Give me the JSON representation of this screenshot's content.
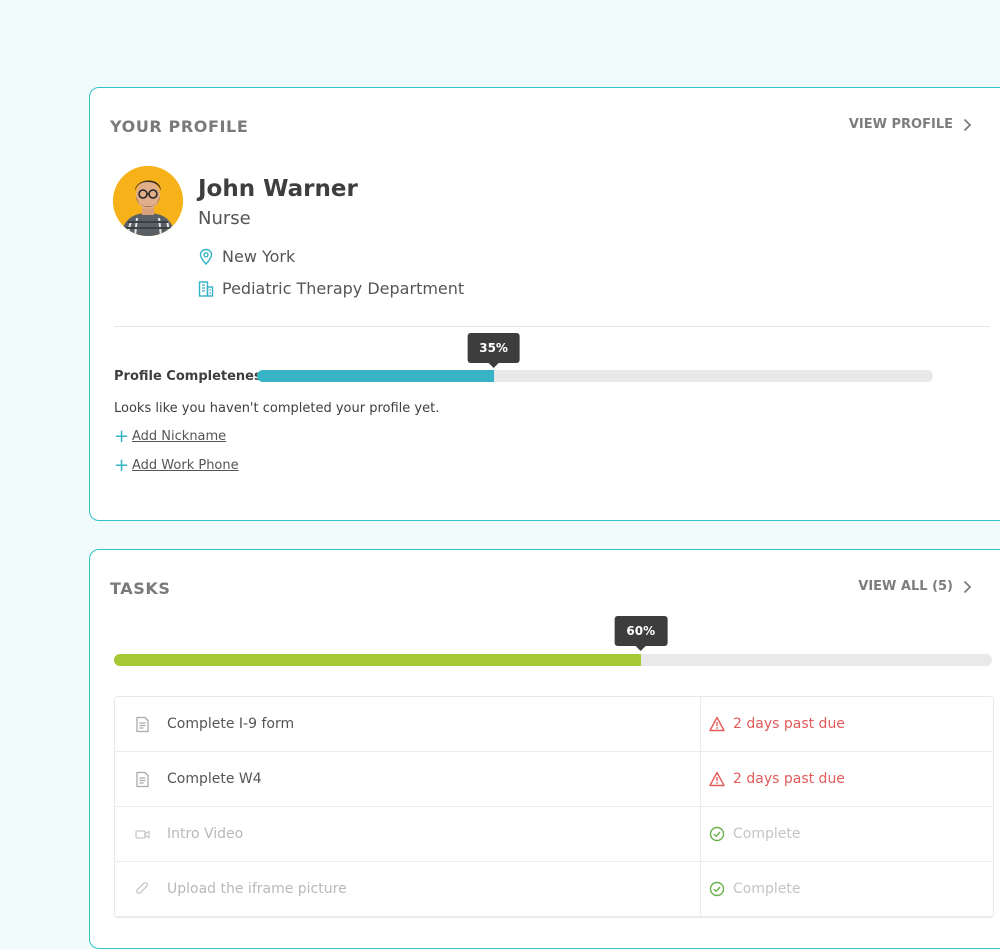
{
  "profile": {
    "title": "YOUR PROFILE",
    "view_link": "VIEW PROFILE",
    "name": "John Warner",
    "role": "Nurse",
    "location": "New York",
    "department": "Pediatric Therapy Department",
    "completeness_label": "Profile Completeness",
    "completeness_value": 35,
    "completeness_text": "35%",
    "note": "Looks like you haven't completed your profile yet.",
    "actions": [
      {
        "label": "Add Nickname"
      },
      {
        "label": "Add Work Phone"
      }
    ]
  },
  "tasks": {
    "title": "TASKS",
    "view_link": "VIEW ALL (5)",
    "progress_value": 60,
    "progress_text": "60%",
    "items": [
      {
        "name": "Complete I-9 form",
        "status": "2 days past due",
        "state": "overdue",
        "icon": "document-icon"
      },
      {
        "name": "Complete W4",
        "status": "2 days past due",
        "state": "overdue",
        "icon": "document-icon"
      },
      {
        "name": "Intro Video",
        "status": "Complete",
        "state": "complete",
        "icon": "video-icon"
      },
      {
        "name": "Upload the iframe picture",
        "status": "Complete",
        "state": "complete",
        "icon": "paperclip-icon"
      }
    ]
  },
  "colors": {
    "accent": "#2ec4c8",
    "profile_bar": "#36b3c7",
    "tasks_bar": "#a4c933",
    "overdue": "#e35b5b",
    "complete": "#6ab04c"
  }
}
